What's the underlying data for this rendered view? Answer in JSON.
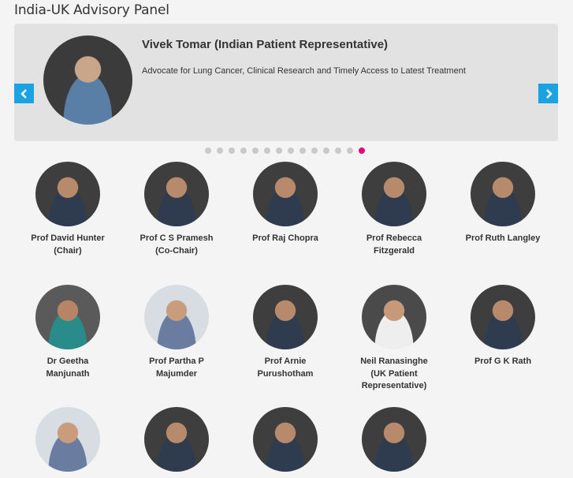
{
  "page": {
    "title": "India-UK Advisory Panel"
  },
  "carousel": {
    "name": "Vivek Tomar (Indian Patient Representative)",
    "description": "Advocate for Lung Cancer, Clinical Research and Timely Access to Latest Treatment",
    "prev_icon": "chevron-left-icon",
    "next_icon": "chevron-right-icon",
    "slide_count": 14,
    "active_slide": 14
  },
  "colors": {
    "accent": "#1aa3e0",
    "active_dot": "#e6007e",
    "dot": "#c9c9c9"
  },
  "members": [
    {
      "name": "Prof David Hunter (Chair)"
    },
    {
      "name": "Prof C S Pramesh (Co-Chair)"
    },
    {
      "name": "Prof Raj Chopra"
    },
    {
      "name": "Prof Rebecca Fitzgerald"
    },
    {
      "name": "Prof Ruth Langley"
    },
    {
      "name": "Dr Geetha Manjunath"
    },
    {
      "name": "Prof Partha P Majumder"
    },
    {
      "name": "Prof Arnie Purushotham"
    },
    {
      "name": "Neil Ranasinghe (UK Patient Representative)"
    },
    {
      "name": "Prof G K Rath"
    },
    {
      "name": ""
    },
    {
      "name": ""
    },
    {
      "name": ""
    },
    {
      "name": ""
    }
  ]
}
